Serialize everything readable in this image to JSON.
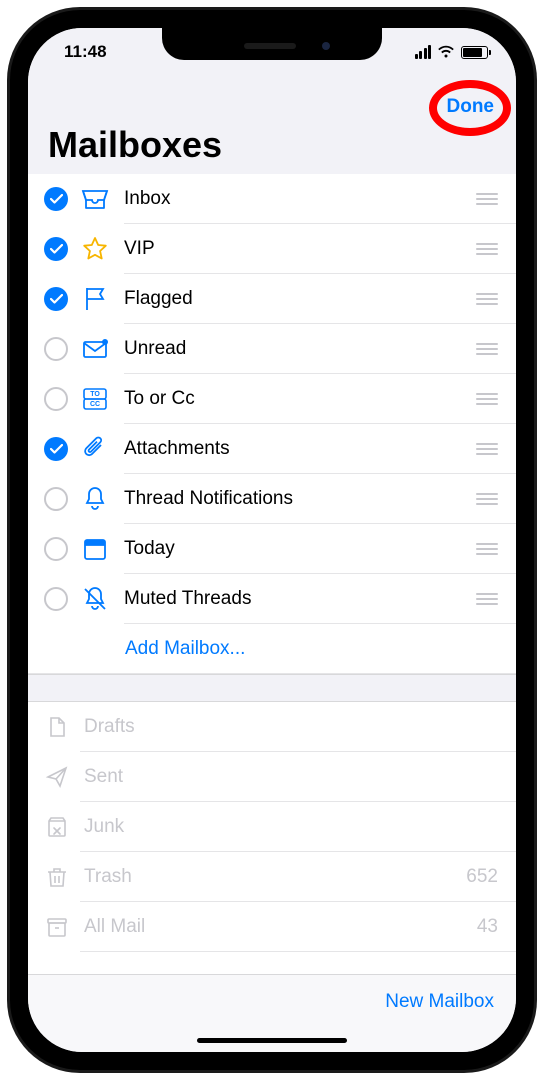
{
  "status": {
    "time": "11:48"
  },
  "nav": {
    "done_label": "Done"
  },
  "title": "Mailboxes",
  "mailbox_items": [
    {
      "label": "Inbox",
      "icon": "tray",
      "checked": true
    },
    {
      "label": "VIP",
      "icon": "star",
      "checked": true
    },
    {
      "label": "Flagged",
      "icon": "flag",
      "checked": true
    },
    {
      "label": "Unread",
      "icon": "envelope-badge",
      "checked": false
    },
    {
      "label": "To or Cc",
      "icon": "tocc",
      "checked": false
    },
    {
      "label": "Attachments",
      "icon": "paperclip",
      "checked": true
    },
    {
      "label": "Thread Notifications",
      "icon": "bell",
      "checked": false
    },
    {
      "label": "Today",
      "icon": "calendar",
      "checked": false
    },
    {
      "label": "Muted Threads",
      "icon": "bell-slash",
      "checked": false
    }
  ],
  "add_mailbox_label": "Add Mailbox...",
  "secondary_items": [
    {
      "label": "Drafts",
      "icon": "doc",
      "count": ""
    },
    {
      "label": "Sent",
      "icon": "paperplane",
      "count": ""
    },
    {
      "label": "Junk",
      "icon": "junk",
      "count": ""
    },
    {
      "label": "Trash",
      "icon": "trash",
      "count": "652"
    },
    {
      "label": "All Mail",
      "icon": "archivebox",
      "count": "43"
    }
  ],
  "toolbar": {
    "new_mailbox_label": "New Mailbox"
  },
  "colors": {
    "accent": "#007aff",
    "star": "#f7b500",
    "highlight": "#ff0000",
    "disabled": "#c7c7cc"
  }
}
